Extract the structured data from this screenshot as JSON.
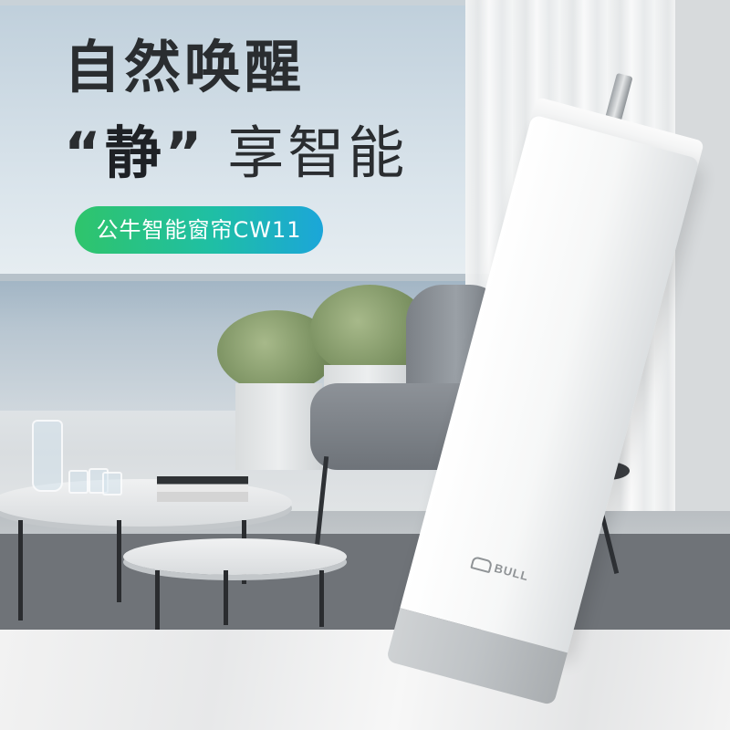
{
  "headline": {
    "line1": "自然唤醒",
    "line2_open_quote": "“",
    "line2_emphasis": "静",
    "line2_close_quote": "”",
    "line2_rest": "享智能"
  },
  "product_badge": "公牛智能窗帘CW11",
  "product": {
    "brand_label": "BULL",
    "brand_icon": "bull-logo-icon"
  },
  "colors": {
    "badge_gradient_start": "#2fc46b",
    "badge_gradient_end": "#1ba6d9",
    "headline_text": "#2a2d30",
    "device_body": "#f6f7f7",
    "device_base": "#bfc3c6"
  }
}
